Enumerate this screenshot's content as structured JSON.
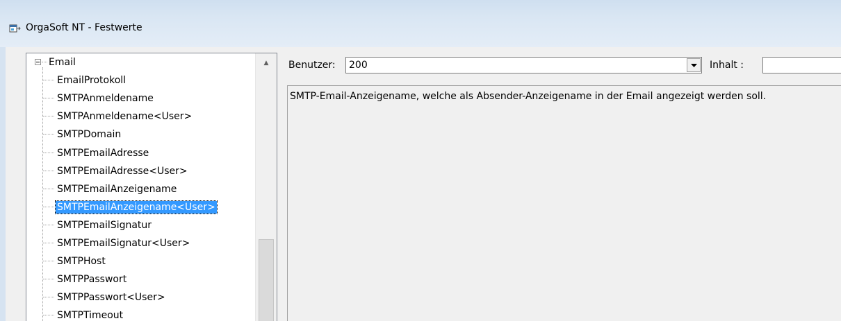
{
  "window": {
    "title": "OrgaSoft NT - Festwerte",
    "icon": "app-icon"
  },
  "tree": {
    "root": {
      "label": "Email",
      "expanded": true
    },
    "items": [
      {
        "label": "EmailProtokoll",
        "selected": false
      },
      {
        "label": "SMTPAnmeldename",
        "selected": false
      },
      {
        "label": "SMTPAnmeldename<User>",
        "selected": false
      },
      {
        "label": "SMTPDomain",
        "selected": false
      },
      {
        "label": "SMTPEmailAdresse",
        "selected": false
      },
      {
        "label": "SMTPEmailAdresse<User>",
        "selected": false
      },
      {
        "label": "SMTPEmailAnzeigename",
        "selected": false
      },
      {
        "label": "SMTPEmailAnzeigename<User>",
        "selected": true
      },
      {
        "label": "SMTPEmailSignatur",
        "selected": false
      },
      {
        "label": "SMTPEmailSignatur<User>",
        "selected": false
      },
      {
        "label": "SMTPHost",
        "selected": false
      },
      {
        "label": "SMTPPasswort",
        "selected": false
      },
      {
        "label": "SMTPPasswort<User>",
        "selected": false
      },
      {
        "label": "SMTPTimeout",
        "selected": false
      }
    ]
  },
  "form": {
    "user_label": "Benutzer:",
    "user_value": "200",
    "inhalt_label": "Inhalt :",
    "inhalt_value": ""
  },
  "description": "SMTP-Email-Anzeigename, welche als Absender-Anzeigename in der Email angezeigt werden soll.",
  "colors": {
    "selection": "#3399ff",
    "window_bg": "#f0f0f0",
    "titlebar": "#d9e6f3"
  }
}
